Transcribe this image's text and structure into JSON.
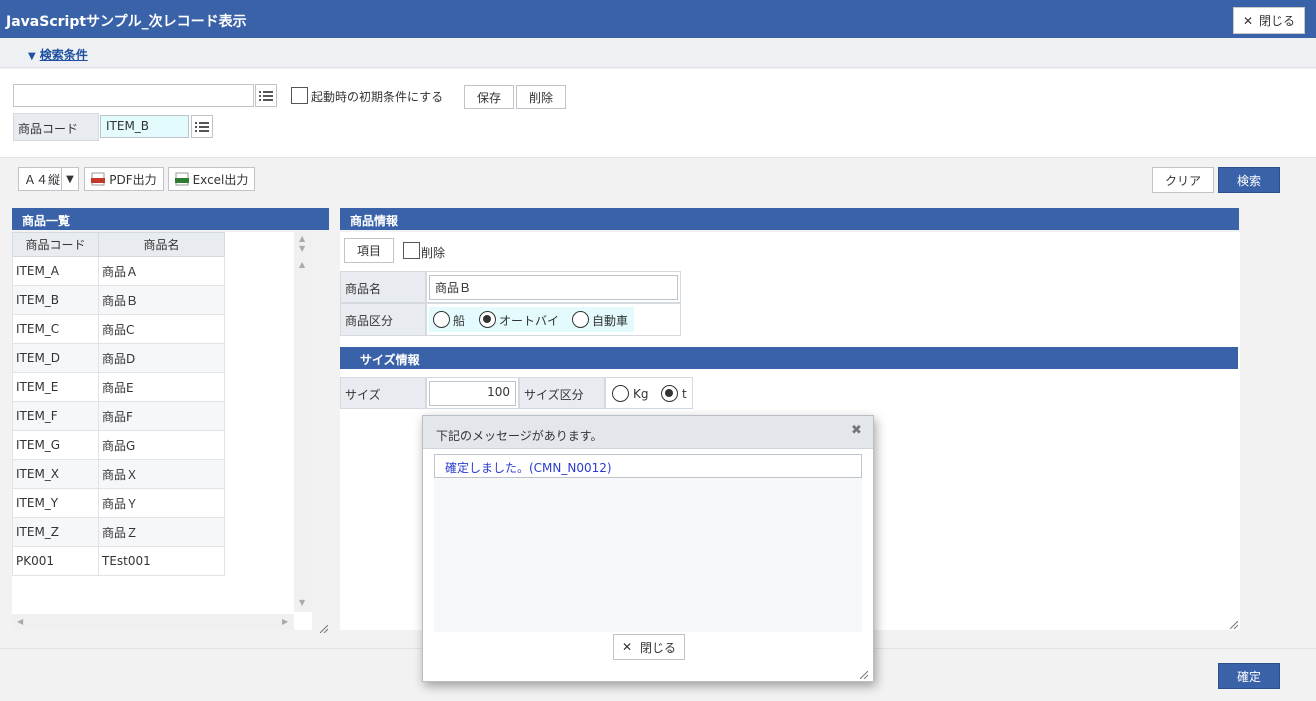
{
  "window": {
    "title": "JavaScriptサンプル_次レコード表示",
    "close_label": "閉じる"
  },
  "condition": {
    "toggle_label": "検索条件",
    "preset_value": "",
    "startup_label": "起動時の初期条件にする",
    "save_label": "保存",
    "delete_label": "削除",
    "product_code_label": "商品コード",
    "product_code_value": "ITEM_B"
  },
  "toolbar": {
    "paper_value": "Ａ４縦",
    "pdf_label": "PDF出力",
    "excel_label": "Excel出力",
    "clear_label": "クリア",
    "search_label": "検索"
  },
  "list": {
    "title": "商品一覧",
    "columns": [
      "商品コード",
      "商品名"
    ],
    "rows": [
      [
        "ITEM_A",
        "商品Ａ"
      ],
      [
        "ITEM_B",
        "商品Ｂ"
      ],
      [
        "ITEM_C",
        "商品C"
      ],
      [
        "ITEM_D",
        "商品D"
      ],
      [
        "ITEM_E",
        "商品E"
      ],
      [
        "ITEM_F",
        "商品F"
      ],
      [
        "ITEM_G",
        "商品G"
      ],
      [
        "ITEM_X",
        "商品Ｘ"
      ],
      [
        "ITEM_Y",
        "商品Ｙ"
      ],
      [
        "ITEM_Z",
        "商品Ｚ"
      ],
      [
        "PK001",
        "TEst001"
      ]
    ]
  },
  "detail": {
    "title": "商品情報",
    "item_button": "項目",
    "delete_label": "削除",
    "name_label": "商品名",
    "name_value": "商品Ｂ",
    "category_label": "商品区分",
    "categories": [
      "船",
      "オートバイ",
      "自動車"
    ],
    "category_selected": "オートバイ"
  },
  "size": {
    "title": "サイズ情報",
    "size_label": "サイズ",
    "size_value": "100",
    "unit_label": "サイズ区分",
    "units": [
      "Kg",
      "t"
    ],
    "unit_selected": "t"
  },
  "footer": {
    "confirm_label": "確定"
  },
  "dialog": {
    "title": "下記のメッセージがあります。",
    "message": "確定しました。(CMN_N0012)",
    "close_label": "閉じる"
  },
  "colors": {
    "header": "#3a62a8",
    "message": "#2b3ccc"
  }
}
